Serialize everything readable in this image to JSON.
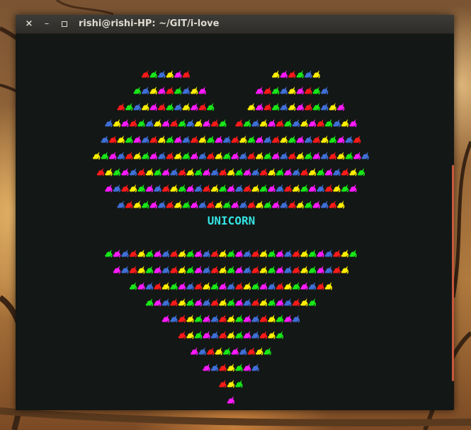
{
  "window": {
    "title": "rishi@rishi-HP: ~/GIT/i-love",
    "close_icon": "×",
    "minimize_icon": "–",
    "maximize_icon": "square"
  },
  "terminal": {
    "center_text": "UNICORN",
    "art_glyph": "unicorn-emoji",
    "heart_rows": [
      6,
      9,
      12,
      15,
      17,
      18,
      17,
      16,
      14,
      11,
      8,
      5,
      3,
      1
    ],
    "heart_rows_top": [
      [
        4,
        8
      ],
      [
        15,
        17
      ],
      [
        20,
        24
      ],
      [
        28,
        31
      ],
      [
        32,
        32
      ],
      [
        34,
        34
      ],
      [
        33,
        33
      ],
      [
        28,
        28
      ],
      [
        24,
        24
      ]
    ],
    "palette": [
      "#ff1a1a",
      "#ffee00",
      "#19e619",
      "#ff1aff",
      "#3f6fd6"
    ],
    "scrollbar_color": "#c8573c"
  }
}
